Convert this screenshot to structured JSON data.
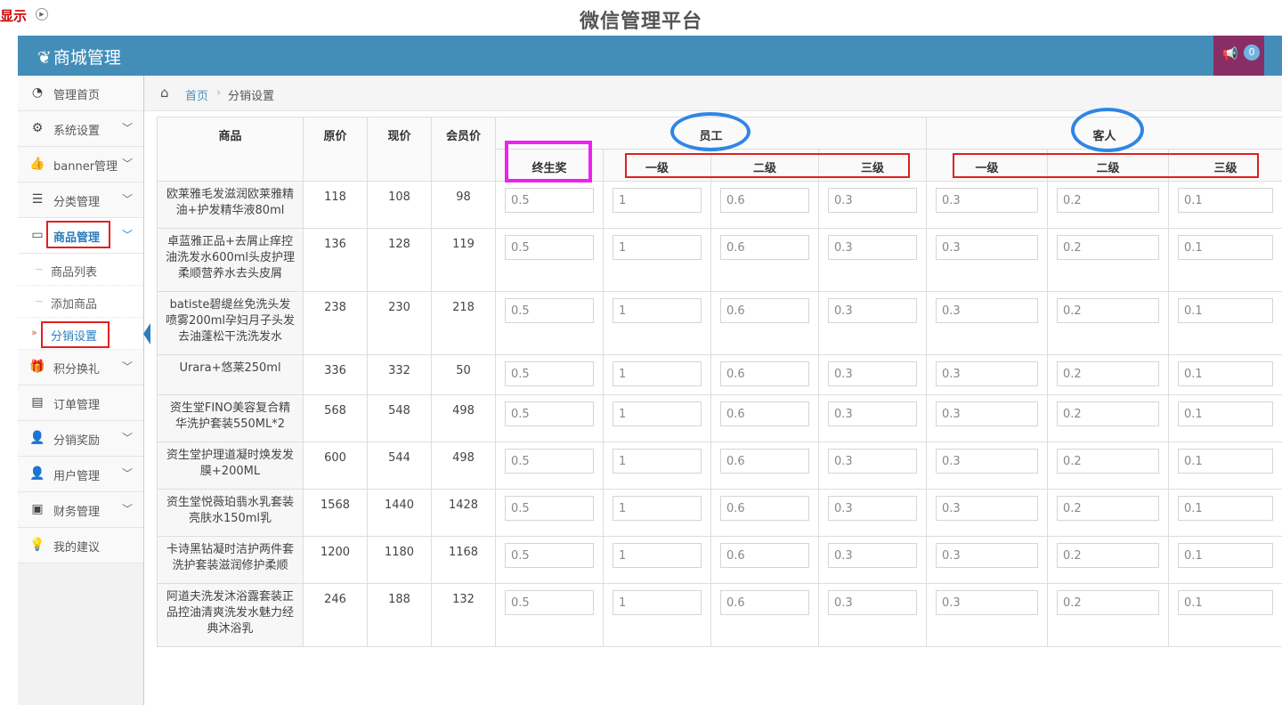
{
  "top": {
    "show_label": "显示",
    "page_title": "微信管理平台"
  },
  "header": {
    "brand": "商城管理",
    "notification_count": "0"
  },
  "sidebar": {
    "items": [
      {
        "label": "管理首页",
        "icon": "dashboard-icon",
        "expandable": false
      },
      {
        "label": "系统设置",
        "icon": "gear-icon",
        "expandable": true
      },
      {
        "label": "banner管理",
        "icon": "thumbs-up-icon",
        "expandable": true
      },
      {
        "label": "分类管理",
        "icon": "list-icon",
        "expandable": true
      },
      {
        "label": "商品管理",
        "icon": "laptop-icon",
        "expandable": true,
        "active": true
      },
      {
        "label": "积分换礼",
        "icon": "gift-icon",
        "expandable": true
      },
      {
        "label": "订单管理",
        "icon": "list-alt-icon",
        "expandable": false
      },
      {
        "label": "分销奖励",
        "icon": "user-icon",
        "expandable": true
      },
      {
        "label": "用户管理",
        "icon": "user-icon",
        "expandable": true
      },
      {
        "label": "财务管理",
        "icon": "inbox-icon",
        "expandable": true
      },
      {
        "label": "我的建议",
        "icon": "lightbulb-icon",
        "expandable": false
      }
    ],
    "subitems": [
      {
        "label": "商品列表"
      },
      {
        "label": "添加商品"
      },
      {
        "label": "分销设置",
        "current": true
      }
    ]
  },
  "breadcrumb": {
    "home": "首页",
    "current": "分销设置"
  },
  "table": {
    "headers": {
      "product": "商品",
      "original_price": "原价",
      "current_price": "现价",
      "member_price": "会员价",
      "employee": "员工",
      "guest": "客人",
      "lifetime": "终生奖",
      "level1": "一级",
      "level2": "二级",
      "level3": "三级"
    },
    "rows": [
      {
        "name": "欧莱雅毛发滋润欧莱雅精油+护发精华液80ml",
        "orig": "118",
        "cur": "108",
        "member": "98",
        "lifetime": "0.5",
        "e1": "1",
        "e2": "0.6",
        "e3": "0.3",
        "g1": "0.3",
        "g2": "0.2",
        "g3": "0.1"
      },
      {
        "name": "卓蓝雅正品+去屑止痒控油洗发水600ml头皮护理柔顺营养水去头皮屑",
        "orig": "136",
        "cur": "128",
        "member": "119",
        "lifetime": "0.5",
        "e1": "1",
        "e2": "0.6",
        "e3": "0.3",
        "g1": "0.3",
        "g2": "0.2",
        "g3": "0.1"
      },
      {
        "name": "batiste碧缇丝免洗头发喷雾200ml孕妇月子头发去油蓬松干洗洗发水",
        "orig": "238",
        "cur": "230",
        "member": "218",
        "lifetime": "0.5",
        "e1": "1",
        "e2": "0.6",
        "e3": "0.3",
        "g1": "0.3",
        "g2": "0.2",
        "g3": "0.1"
      },
      {
        "name": "Urara+悠莱250ml",
        "orig": "336",
        "cur": "332",
        "member": "50",
        "lifetime": "0.5",
        "e1": "1",
        "e2": "0.6",
        "e3": "0.3",
        "g1": "0.3",
        "g2": "0.2",
        "g3": "0.1"
      },
      {
        "name": "资生堂FINO美容复合精华洗护套装550ML*2",
        "orig": "568",
        "cur": "548",
        "member": "498",
        "lifetime": "0.5",
        "e1": "1",
        "e2": "0.6",
        "e3": "0.3",
        "g1": "0.3",
        "g2": "0.2",
        "g3": "0.1"
      },
      {
        "name": "资生堂护理道凝时焕发发膜+200ML",
        "orig": "600",
        "cur": "544",
        "member": "498",
        "lifetime": "0.5",
        "e1": "1",
        "e2": "0.6",
        "e3": "0.3",
        "g1": "0.3",
        "g2": "0.2",
        "g3": "0.1"
      },
      {
        "name": "资生堂悦薇珀翡水乳套装亮肤水150ml乳",
        "orig": "1568",
        "cur": "1440",
        "member": "1428",
        "lifetime": "0.5",
        "e1": "1",
        "e2": "0.6",
        "e3": "0.3",
        "g1": "0.3",
        "g2": "0.2",
        "g3": "0.1"
      },
      {
        "name": "卡诗黑钻凝时洁护两件套洗护套装滋润修护柔顺",
        "orig": "1200",
        "cur": "1180",
        "member": "1168",
        "lifetime": "0.5",
        "e1": "1",
        "e2": "0.6",
        "e3": "0.3",
        "g1": "0.3",
        "g2": "0.2",
        "g3": "0.1"
      },
      {
        "name": "阿道夫洗发沐浴露套装正品控油清爽洗发水魅力经典沐浴乳",
        "orig": "246",
        "cur": "188",
        "member": "132",
        "lifetime": "0.5",
        "e1": "1",
        "e2": "0.6",
        "e3": "0.3",
        "g1": "0.3",
        "g2": "0.2",
        "g3": "0.1"
      }
    ]
  },
  "annotation_colors": {
    "red_box": "#e02020",
    "magenta_box": "#ee22ee",
    "blue_ellipse": "#2f86e4"
  }
}
